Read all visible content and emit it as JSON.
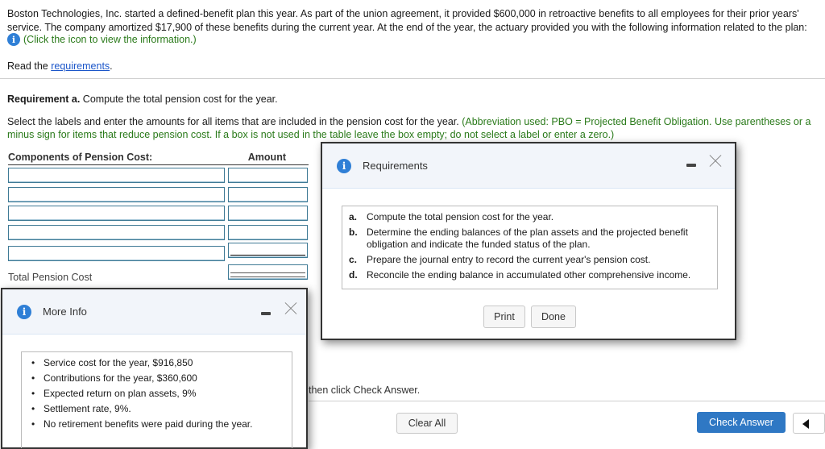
{
  "problem": {
    "intro": "Boston Technologies, Inc. started a defined-benefit plan this year. As part of the union agreement, it provided $600,000 in retroactive benefits to all employees for their prior years' service. The company amortized $17,900 of these benefits during the current year. At the end of the year, the actuary provided you with the following information related to the plan:",
    "info_link_text": "(Click the icon to view the information.)",
    "read_prefix": "Read the ",
    "read_link": "requirements",
    "read_suffix": "."
  },
  "requirement": {
    "label": "Requirement a.",
    "text": " Compute the total pension cost for the year.",
    "instruction": "Select the labels and enter the amounts for all items that are included in the pension cost for the year. ",
    "instruction_green": "(Abbreviation used: PBO = Projected Benefit Obligation. Use parentheses or a minus sign for items that reduce pension cost. If a box is not used in the table leave the box empty; do not select a label or enter a zero.)"
  },
  "table": {
    "col1_header": "Components of Pension Cost:",
    "col2_header": "Amount",
    "rows": [
      {
        "label": "",
        "amount": ""
      },
      {
        "label": "",
        "amount": ""
      },
      {
        "label": "",
        "amount": ""
      },
      {
        "label": "",
        "amount": ""
      },
      {
        "label": "",
        "amount": ""
      }
    ],
    "total_label": "Total Pension Cost",
    "total_amount": ""
  },
  "footer": {
    "hint": "then click Check Answer.",
    "clear_all": "Clear All",
    "check_answer": "Check Answer"
  },
  "requirements_dialog": {
    "title": "Requirements",
    "items": [
      {
        "letter": "a.",
        "text": "Compute the total pension cost for the year."
      },
      {
        "letter": "b.",
        "text": "Determine the ending balances of the plan assets and the projected benefit obligation and indicate the funded status of the plan."
      },
      {
        "letter": "c.",
        "text": "Prepare the journal entry to record the current year's pension cost."
      },
      {
        "letter": "d.",
        "text": "Reconcile the ending balance in accumulated other comprehensive income."
      }
    ],
    "print": "Print",
    "done": "Done"
  },
  "more_info_dialog": {
    "title": "More Info",
    "items": [
      "Service cost for the year, $916,850",
      "Contributions for the year, $360,600",
      "Expected return on plan assets, 9%",
      "Settlement rate, 9%.",
      "No retirement benefits were paid during the year."
    ]
  },
  "icons": {
    "info": "i",
    "bullet": "•"
  },
  "colors": {
    "accent_blue": "#2f78c4",
    "info_green": "#2a7a1a",
    "link_blue": "#1a55c9"
  }
}
